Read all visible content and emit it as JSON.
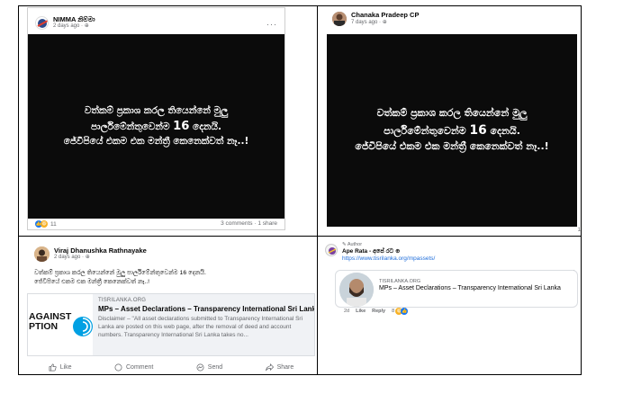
{
  "shared_text": {
    "line1": "වත්කම් ප්‍රකාශ කරල තියෙන්නේ මුලු",
    "line2_pre": "පාර්ලිමේන්තුවෙන්ම ",
    "line2_num": "16",
    "line2_post": " දෙනයි.",
    "line3": "ජේවීපියේ එකම එක මන්ත්‍රී කෙනෙක්වත් නෑ..!"
  },
  "post1": {
    "author": "NIMMA නිම්මා",
    "meta": "2 days ago · ⊕",
    "more": "···",
    "reaction_count": "11",
    "stats": "3 comments · 1 share"
  },
  "post2": {
    "author": "Chanaka Pradeep CP",
    "meta": "7 days ago · ⊕",
    "fragment": "1"
  },
  "post3": {
    "author": "Viraj Dhanushka Rathnayake",
    "meta": "2 days ago · ⊕",
    "text_line1": "වත්කම් ප්‍රකාශ කරල තියෙන්නේ මුලු පාර්ලිමේන්තුවෙන්ම 16 දෙනයි.",
    "text_line2": "ජේවීපියේ එකම එක මන්ත්‍රී කෙනෙක්වත් නෑ..!",
    "card": {
      "thumb_text_1": "AGAINST",
      "thumb_text_2": "PTION",
      "domain": "TISRILANKA.ORG",
      "title": "MPs – Asset Declarations – Transparency International Sri Lanka",
      "description": "Disclaimer – \"All asset declarations submitted to Transparency International Sri Lanka are posted on this web page, after the removal of deed and account numbers. Transparency International Sri Lanka takes no..."
    },
    "actions": {
      "like": "Like",
      "comment": "Comment",
      "send": "Send",
      "share": "Share"
    }
  },
  "post4": {
    "author_tag": "✎ Author",
    "name": "Ape Rata - අපේ රට ⊕",
    "link": "https://www.tisrilanka.org/mpassets/",
    "card": {
      "domain": "TISRILANKA.ORG",
      "title": "MPs – Asset Declarations – Transparency International Sri Lanka"
    },
    "time": "2d",
    "like": "Like",
    "reply": "Reply",
    "reaction_count": "8"
  },
  "colors": {
    "panel": "#0b0b0b",
    "link": "#216fdb",
    "fb_blue": "#1877f2"
  }
}
